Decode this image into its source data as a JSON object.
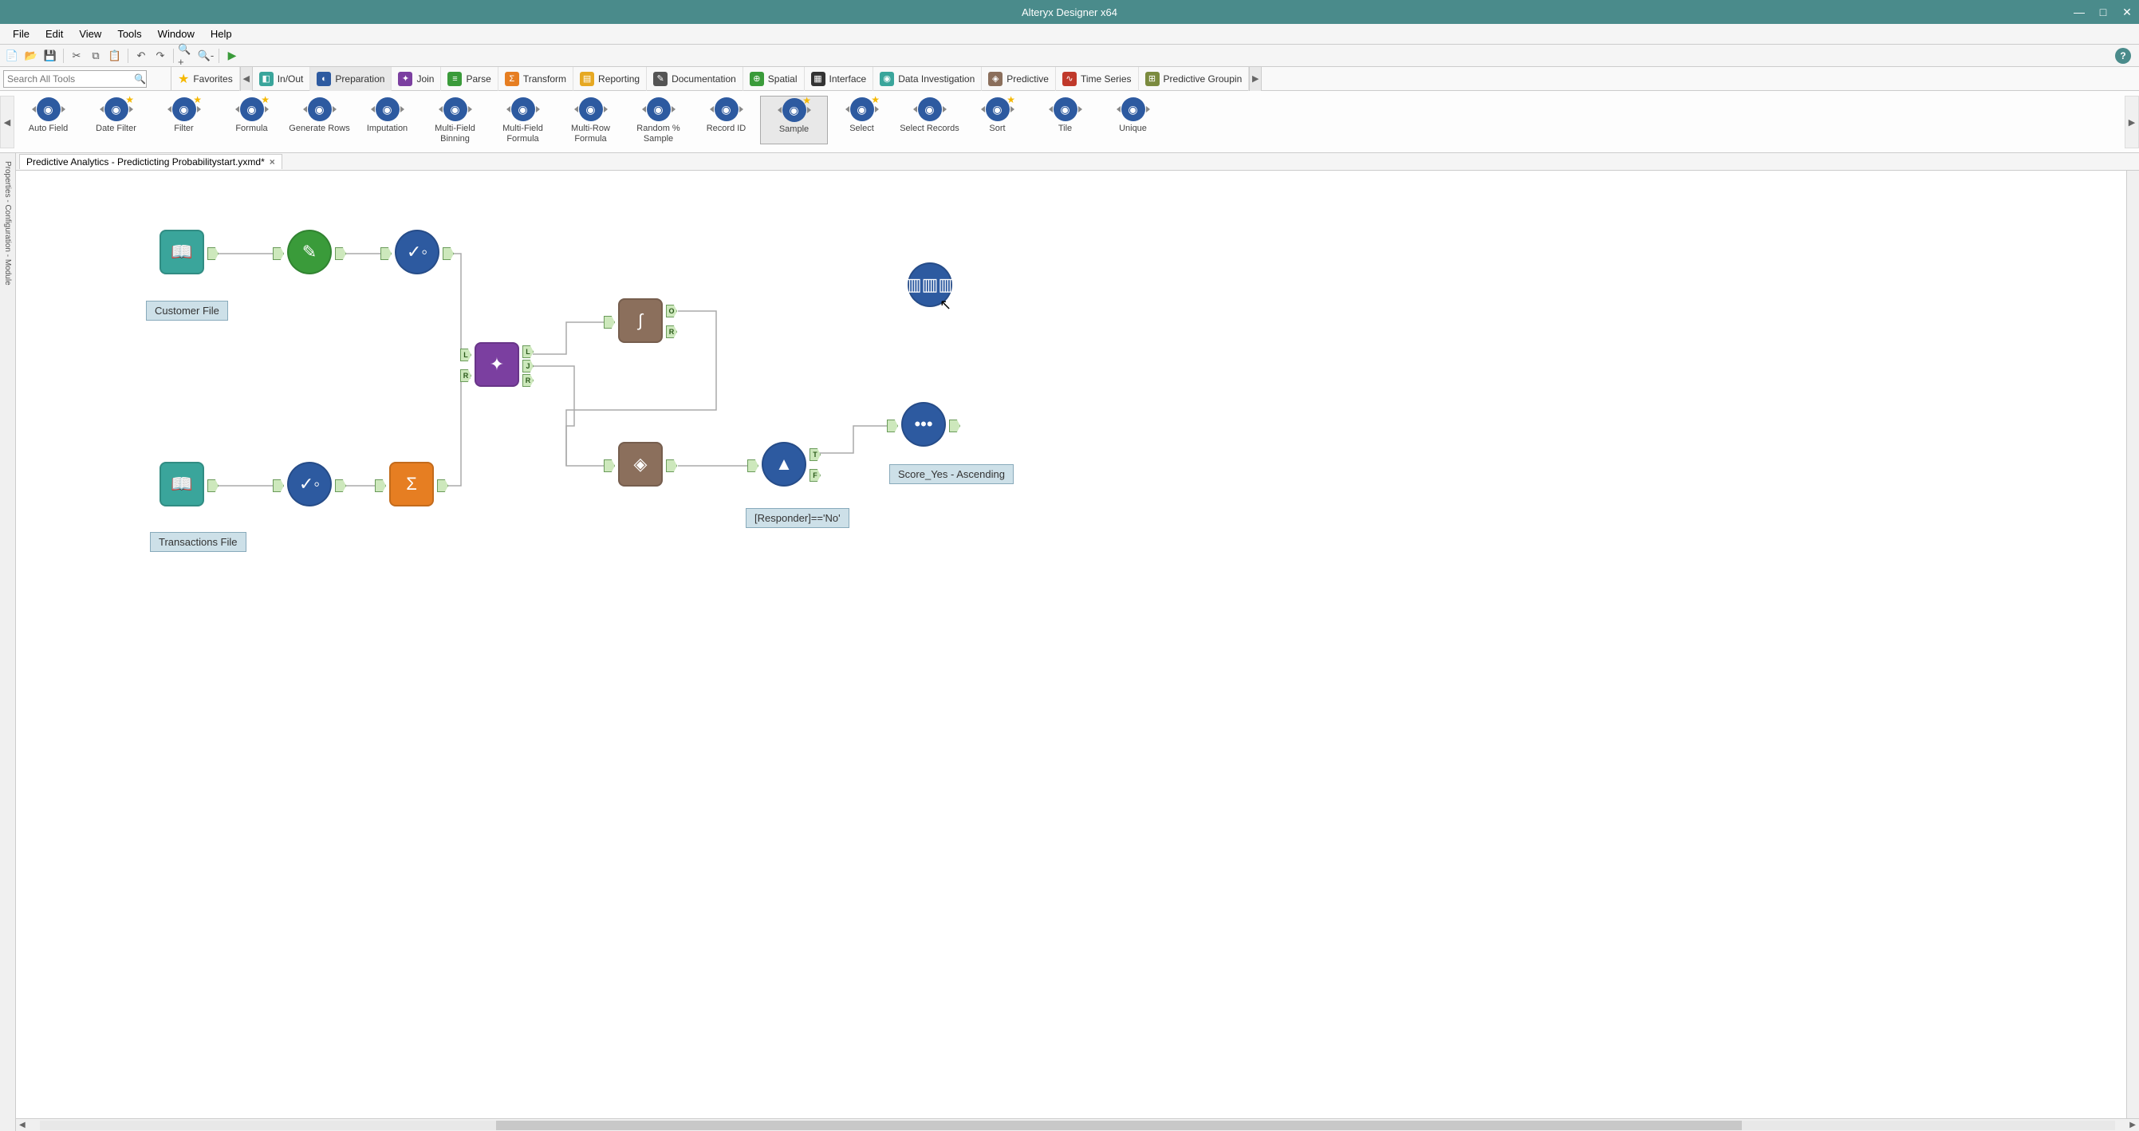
{
  "app": {
    "title": "Alteryx Designer x64"
  },
  "menu": {
    "items": [
      "File",
      "Edit",
      "View",
      "Tools",
      "Window",
      "Help"
    ]
  },
  "toolbar1": {
    "help": "?"
  },
  "search": {
    "placeholder": "Search All Tools"
  },
  "categories": {
    "favorites": "Favorites",
    "items": [
      "In/Out",
      "Preparation",
      "Join",
      "Parse",
      "Transform",
      "Reporting",
      "Documentation",
      "Spatial",
      "Interface",
      "Data Investigation",
      "Predictive",
      "Time Series",
      "Predictive Groupin"
    ]
  },
  "palette": {
    "tools": [
      {
        "label": "Auto Field",
        "star": false
      },
      {
        "label": "Date Filter",
        "star": true
      },
      {
        "label": "Filter",
        "star": true
      },
      {
        "label": "Formula",
        "star": true
      },
      {
        "label": "Generate Rows",
        "star": false
      },
      {
        "label": "Imputation",
        "star": false
      },
      {
        "label": "Multi-Field Binning",
        "star": false
      },
      {
        "label": "Multi-Field Formula",
        "star": false
      },
      {
        "label": "Multi-Row Formula",
        "star": false
      },
      {
        "label": "Random % Sample",
        "star": false
      },
      {
        "label": "Record ID",
        "star": false
      },
      {
        "label": "Sample",
        "star": true,
        "selected": true
      },
      {
        "label": "Select",
        "star": true
      },
      {
        "label": "Select Records",
        "star": false
      },
      {
        "label": "Sort",
        "star": true
      },
      {
        "label": "Tile",
        "star": false
      },
      {
        "label": "Unique",
        "star": false
      }
    ]
  },
  "tab": {
    "title": "Predictive Analytics - Predicticting Probabilitystart.yxmd*"
  },
  "sidebar": {
    "label": "Properties - Configuration - Module"
  },
  "canvas": {
    "labels": {
      "customer": "Customer File",
      "transactions": "Transactions File",
      "responder": "[Responder]=='No'",
      "score": "Score_Yes - Ascending"
    },
    "anchors": {
      "L": "L",
      "J": "J",
      "R": "R",
      "O": "O",
      "T": "T",
      "F": "F"
    }
  }
}
